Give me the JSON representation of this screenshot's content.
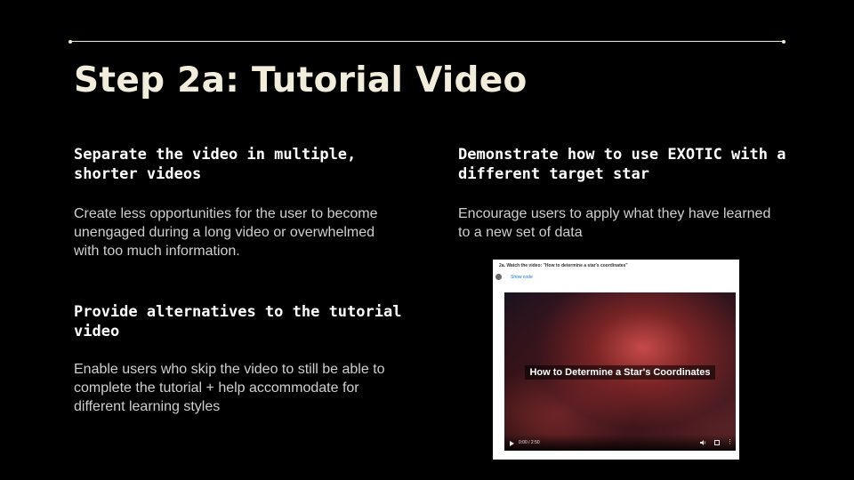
{
  "slide": {
    "title": "Step 2a: Tutorial Video",
    "accent_color": "#f2ecdc"
  },
  "sections": [
    {
      "heading": "Separate the video in multiple, shorter videos",
      "body": "Create less opportunities for the user to become unengaged during a long video or overwhelmed with too much information."
    },
    {
      "heading": "Provide alternatives to the tutorial video",
      "body": "Enable users who skip the video to still be able to complete the tutorial + help accommodate for different learning styles"
    },
    {
      "heading": "Demonstrate how to use EXOTIC with a different target star",
      "body": "Encourage users to apply what they have learned to a new set of data"
    }
  ],
  "screenshot": {
    "cell_title": "2a. Watch the video: \"How to determine a star's coordinates\"",
    "show_code_label": "Show code",
    "video_caption": "How to Determine a Star's Coordinates",
    "video_time": "0:00 / 2:50"
  }
}
